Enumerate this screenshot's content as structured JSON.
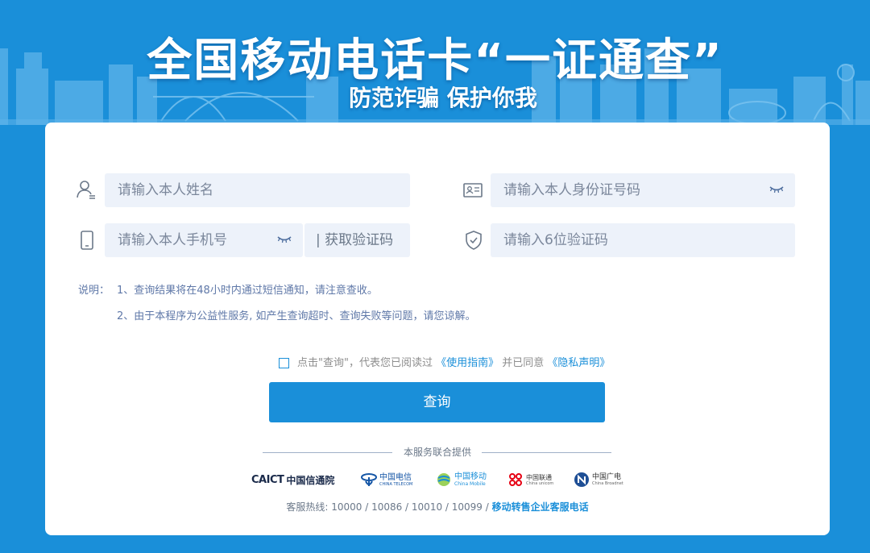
{
  "banner": {
    "title": "全国移动电话卡“一证通查”",
    "subtitle": "防范诈骗 保护你我"
  },
  "form": {
    "name_placeholder": "请输入本人姓名",
    "id_placeholder": "请输入本人身份证号码",
    "phone_placeholder": "请输入本人手机号",
    "get_code_label": "| 获取验证码",
    "code_placeholder": "请输入6位验证码"
  },
  "notes": {
    "label": "说明：",
    "line1": "1、查询结果将在48小时内通过短信通知，请注意查收。",
    "line2": "2、由于本程序为公益性服务, 如产生查询超时、查询失败等问题，请您谅解。"
  },
  "agreement": {
    "prefix": "点击\"查询\"，代表您已阅读过",
    "guide_link": "《使用指南》",
    "middle": "并已同意",
    "privacy_link": "《隐私声明》"
  },
  "query_button_label": "查询",
  "footer": {
    "provided_by": "本服务联合提供",
    "logos": {
      "caict_mark": "CAICT",
      "caict_name": "中国信通院",
      "telecom_name": "中国电信",
      "telecom_en": "CHINA TELECOM",
      "mobile_name": "中国移动",
      "mobile_en": "China Mobile",
      "unicom_name": "中国联通",
      "unicom_en": "China unicom",
      "broadnet_name": "中国广电",
      "broadnet_en": "China Broadnet"
    },
    "hotline_text": "客服热线: 10000 / 10086 / 10010 / 10099 /",
    "enterprise_link": "移动转售企业客服电话"
  },
  "colors": {
    "background": "#1a8fd9",
    "accent": "#1a8fd9",
    "input_bg": "#edf2fa",
    "card": "#ffffff"
  },
  "icons": [
    "user-icon",
    "id-card-icon",
    "phone-icon",
    "shield-check-icon",
    "eye-closed-icon",
    "checkbox"
  ]
}
